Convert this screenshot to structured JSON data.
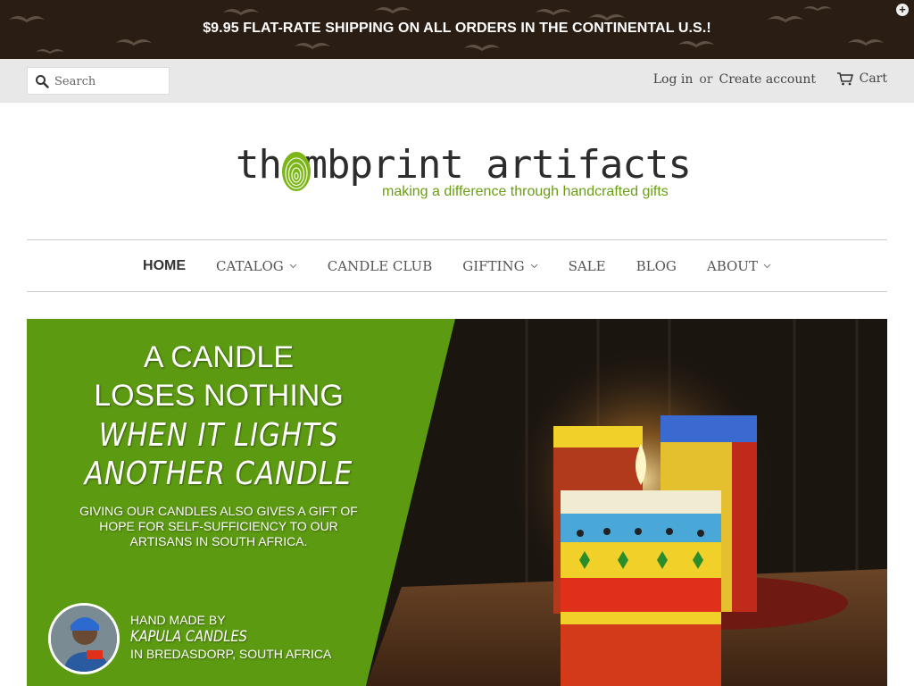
{
  "announcement": {
    "text": "$9.95 FLAT-RATE SHIPPING ON ALL ORDERS IN THE CONTINENTAL U.S.!"
  },
  "search": {
    "placeholder": "Search",
    "icon": "search-icon"
  },
  "account": {
    "login": "Log in",
    "or": "or",
    "create": "Create account"
  },
  "cart": {
    "label": "Cart",
    "icon": "cart-icon"
  },
  "logo": {
    "wordmark": "th  mbprint artifacts",
    "tagline": "making a difference through handcrafted gifts"
  },
  "nav": {
    "items": [
      {
        "label": "HOME",
        "dropdown": false
      },
      {
        "label": "CATALOG",
        "dropdown": true
      },
      {
        "label": "CANDLE CLUB",
        "dropdown": false
      },
      {
        "label": "GIFTING",
        "dropdown": true
      },
      {
        "label": "SALE",
        "dropdown": false
      },
      {
        "label": "BLOG",
        "dropdown": false
      },
      {
        "label": "ABOUT",
        "dropdown": true
      }
    ]
  },
  "hero": {
    "line1": "A CANDLE",
    "line2": "LOSES NOTHING",
    "line3": "WHEN IT LIGHTS",
    "line4": "ANOTHER CANDLE",
    "subtext": "GIVING OUR CANDLES ALSO GIVES A GIFT OF HOPE FOR SELF-SUFFICIENCY TO OUR ARTISANS IN SOUTH AFRICA.",
    "maker_prefix": "HAND MADE BY",
    "maker_name": "KAPULA CANDLES",
    "maker_location": "IN BREDASDORP, SOUTH AFRICA"
  },
  "colors": {
    "accent_green": "#6a9e14",
    "hero_green": "#5c9a12",
    "announce_bg": "#2a1d14"
  }
}
